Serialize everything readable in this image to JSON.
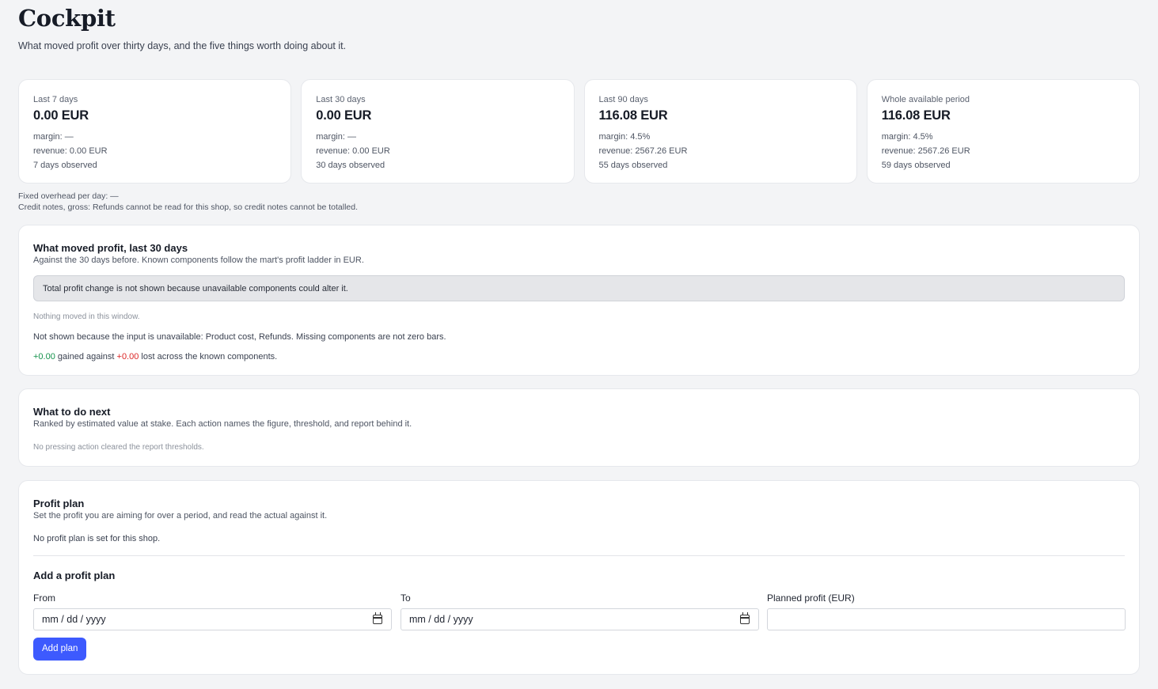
{
  "header": {
    "title": "Cockpit",
    "subtitle": "What moved profit over thirty days, and the five things worth doing about it."
  },
  "kpis": [
    {
      "label": "Last 7 days",
      "value": "0.00 EUR",
      "margin": "margin: —",
      "revenue": "revenue: 0.00 EUR",
      "observed": "7 days observed"
    },
    {
      "label": "Last 30 days",
      "value": "0.00 EUR",
      "margin": "margin: —",
      "revenue": "revenue: 0.00 EUR",
      "observed": "30 days observed"
    },
    {
      "label": "Last 90 days",
      "value": "116.08 EUR",
      "margin": "margin: 4.5%",
      "revenue": "revenue: 2567.26 EUR",
      "observed": "55 days observed"
    },
    {
      "label": "Whole available period",
      "value": "116.08 EUR",
      "margin": "margin: 4.5%",
      "revenue": "revenue: 2567.26 EUR",
      "observed": "59 days observed"
    }
  ],
  "notes": {
    "overhead": "Fixed overhead per day: —",
    "credit_notes": "Credit notes, gross: Refunds cannot be read for this shop, so credit notes cannot be totalled."
  },
  "moved": {
    "title": "What moved profit, last 30 days",
    "description": "Against the 30 days before. Known components follow the mart's profit ladder in EUR.",
    "banner": "Total profit change is not shown because unavailable components could alter it.",
    "empty": "Nothing moved in this window.",
    "missing": "Not shown because the input is unavailable: Product cost, Refunds. Missing components are not zero bars.",
    "gained_value": "+0.00",
    "gained_text": " gained against ",
    "lost_value": "+0.00",
    "lost_text": " lost across the known components."
  },
  "next": {
    "title": "What to do next",
    "description": "Ranked by estimated value at stake. Each action names the figure, threshold, and report behind it.",
    "empty": "No pressing action cleared the report thresholds."
  },
  "plan": {
    "title": "Profit plan",
    "description": "Set the profit you are aiming for over a period, and read the actual against it.",
    "empty": "No profit plan is set for this shop.",
    "form_title": "Add a profit plan",
    "from_label": "From",
    "from_value": "mm / dd / yyyy",
    "to_label": "To",
    "to_value": "mm / dd / yyyy",
    "amount_label": "Planned profit (EUR)",
    "amount_value": "",
    "submit": "Add plan"
  },
  "colors": {
    "gain": "#15924c",
    "loss": "#dc2626",
    "accent": "#3d5afe"
  }
}
